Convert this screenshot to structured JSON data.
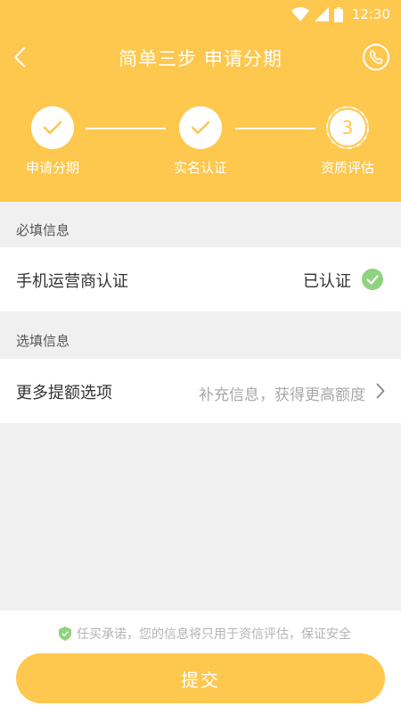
{
  "status_bar": {
    "time": "12:30"
  },
  "nav": {
    "title": "简单三步 申请分期"
  },
  "steps": [
    {
      "label": "申请分期",
      "state": "done"
    },
    {
      "label": "实名认证",
      "state": "done"
    },
    {
      "label": "资质评估",
      "state": "current",
      "number": "3"
    }
  ],
  "required": {
    "section_label": "必填信息",
    "item": {
      "title": "手机运营商认证",
      "status": "已认证"
    }
  },
  "optional": {
    "section_label": "选填信息",
    "item": {
      "title": "更多提额选项",
      "hint": "补充信息，获得更高额度"
    }
  },
  "notice": "任买承诺，您的信息将只用于资信评估，保证安全",
  "submit_label": "提交",
  "colors": {
    "accent": "#fec74d",
    "success": "#8fd27f",
    "background": "#f0f0f0"
  }
}
